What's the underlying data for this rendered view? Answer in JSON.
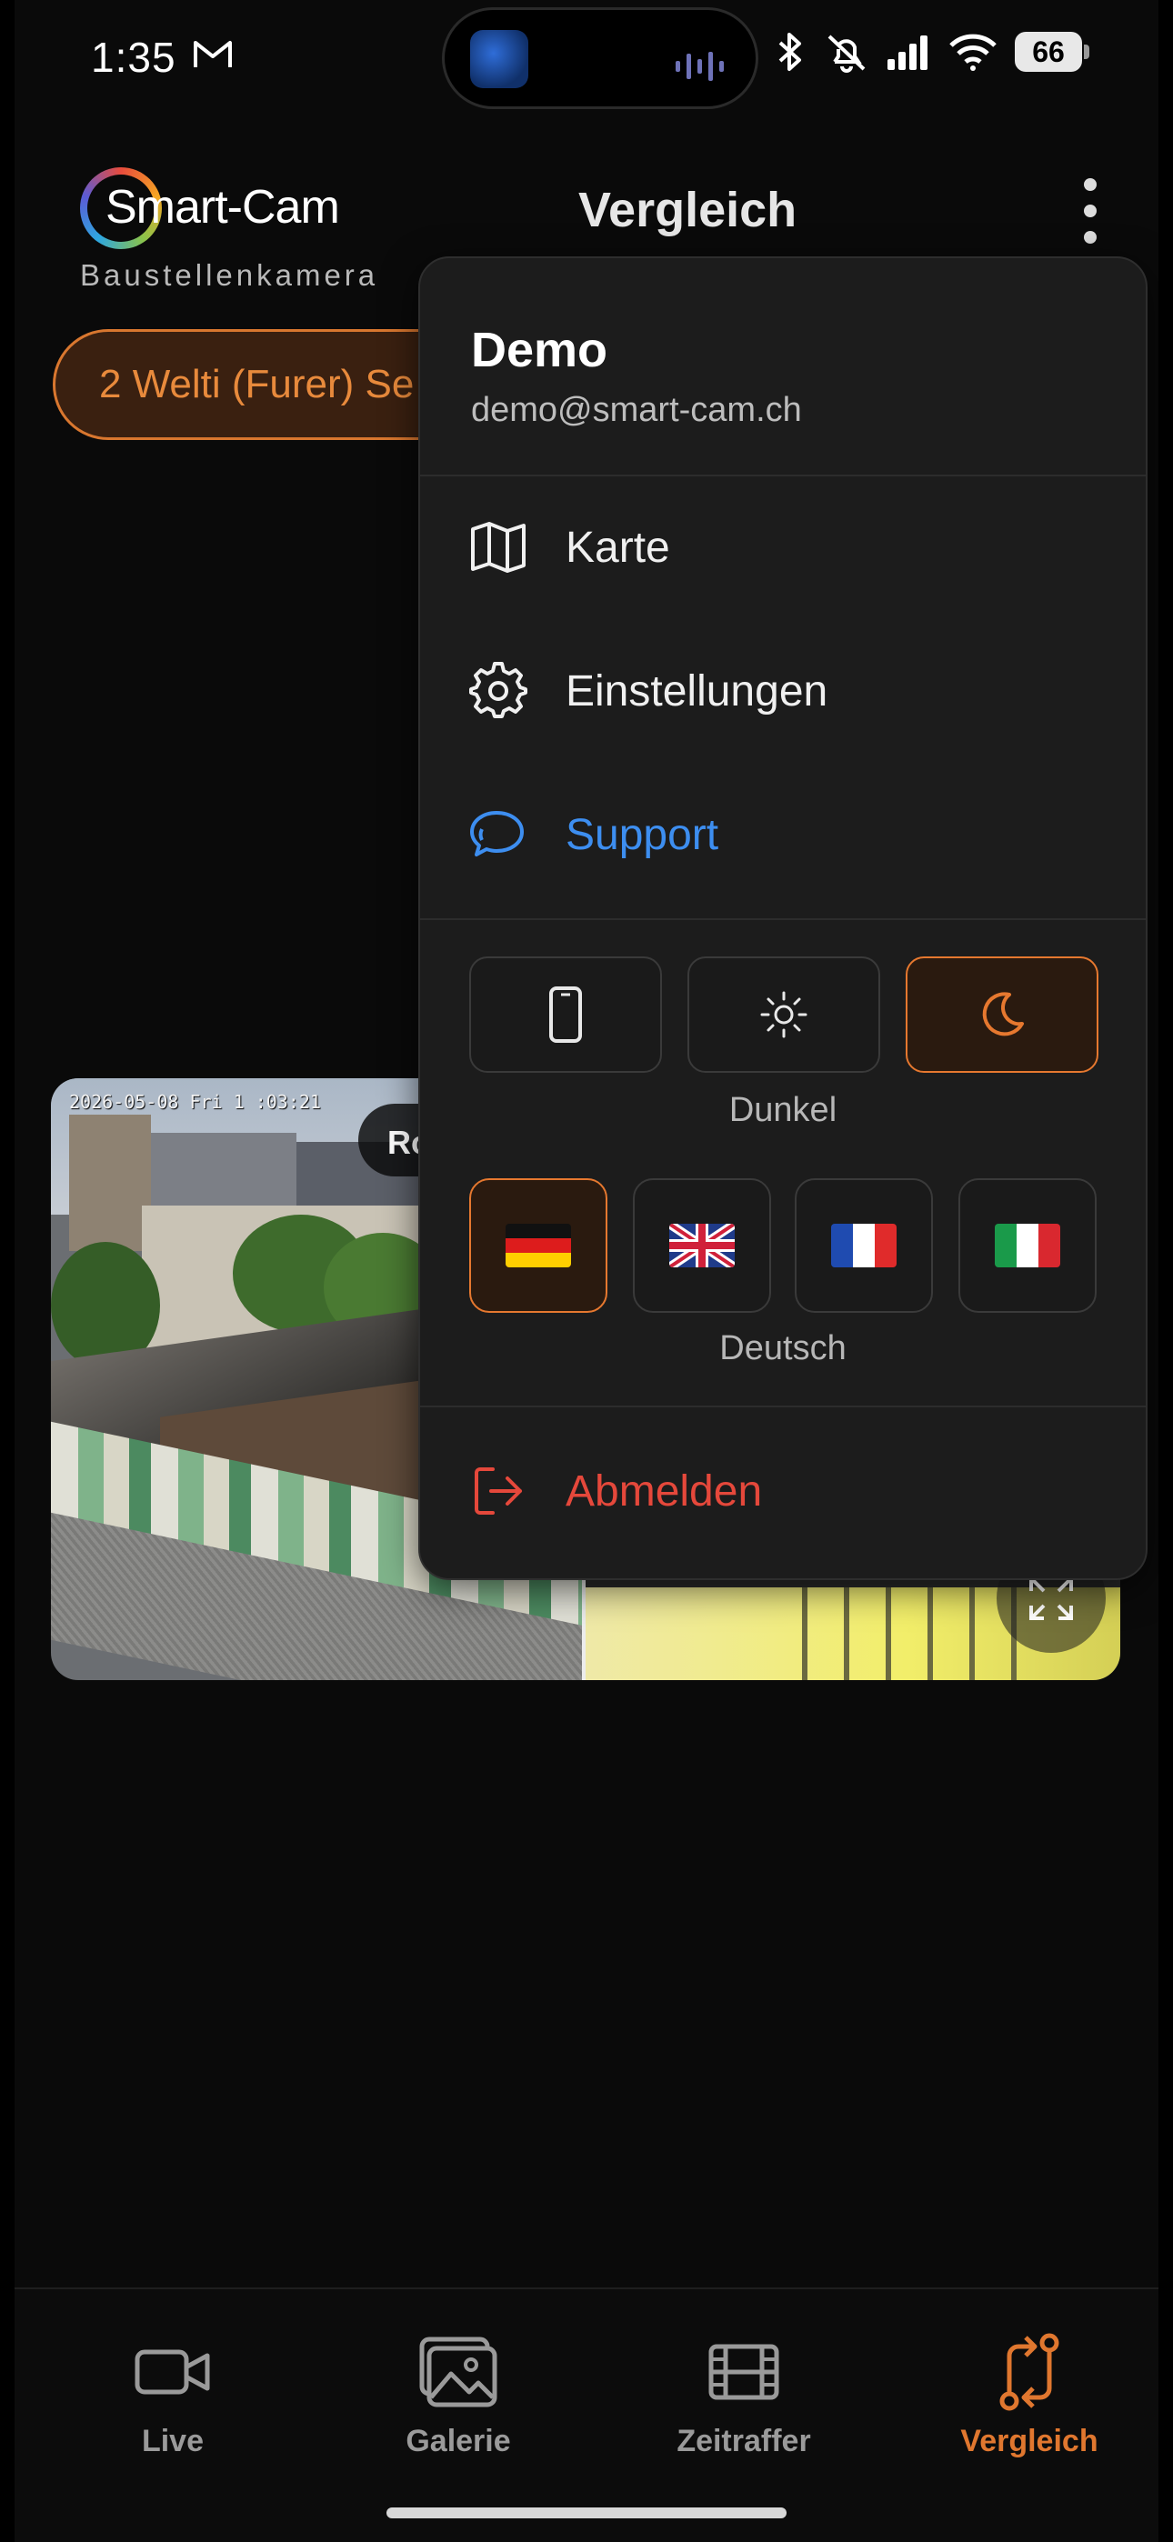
{
  "status_bar": {
    "time": "1:35",
    "battery": "66"
  },
  "header": {
    "logo_text": "Smart-Cam",
    "logo_subtitle": "Baustellenkamera",
    "title": "Vergleich"
  },
  "site_selector": {
    "label": "2 Welti (Furer) Se"
  },
  "camera": {
    "timestamp": "2026-05-08 Fri 1 :03:21",
    "badge": "Ro"
  },
  "menu": {
    "user_name": "Demo",
    "user_email": "demo@smart-cam.ch",
    "items": [
      {
        "label": "Karte",
        "icon": "map-icon"
      },
      {
        "label": "Einstellungen",
        "icon": "gear-icon"
      },
      {
        "label": "Support",
        "icon": "chat-bubbles-icon"
      }
    ],
    "theme_options": [
      "system",
      "light",
      "dark"
    ],
    "theme_selected": "dark",
    "theme_label": "Dunkel",
    "languages": [
      "de",
      "en",
      "fr",
      "it"
    ],
    "language_selected": "de",
    "language_label": "Deutsch",
    "logout_label": "Abmelden"
  },
  "bottom_nav": {
    "items": [
      {
        "label": "Live",
        "icon": "video-camera-icon"
      },
      {
        "label": "Galerie",
        "icon": "gallery-icon"
      },
      {
        "label": "Zeitraffer",
        "icon": "film-icon"
      },
      {
        "label": "Vergleich",
        "icon": "compare-icon"
      }
    ],
    "active": "Vergleich"
  },
  "colors": {
    "accent": "#e6782f",
    "link": "#3d8ef0",
    "danger": "#e5483b",
    "background": "#0a0a0a",
    "menu_bg": "#1c1c1c"
  }
}
